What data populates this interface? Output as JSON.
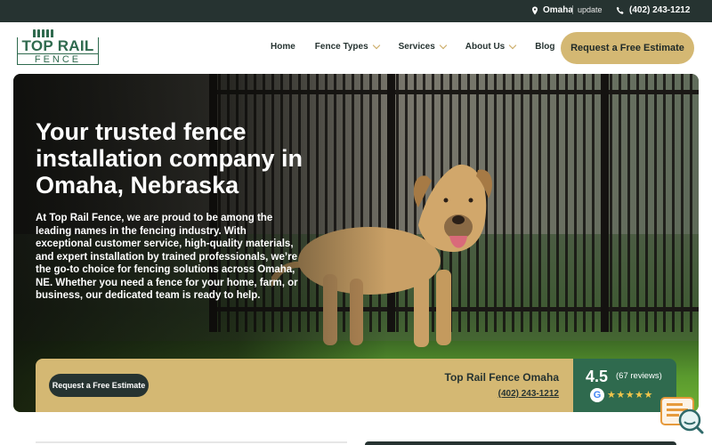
{
  "topbar": {
    "location": "Omaha",
    "update": "update",
    "phone": "(402) 243-1212"
  },
  "logo": {
    "line1": "TOP RAIL",
    "line2": "FENCE"
  },
  "nav": {
    "items": [
      {
        "label": "Home",
        "dropdown": false
      },
      {
        "label": "Fence Types",
        "dropdown": true
      },
      {
        "label": "Services",
        "dropdown": true
      },
      {
        "label": "About Us",
        "dropdown": true
      },
      {
        "label": "Blog",
        "dropdown": false
      }
    ],
    "cta": "Request a Free Estimate"
  },
  "hero": {
    "title": "Your trusted fence installation company in Omaha, Nebraska",
    "body": "At Top Rail Fence, we are proud to be among the leading names in the fencing industry. With exceptional customer service, high-quality materials, and expert installation by trained professionals, we’re the go-to choice for fencing solutions across Omaha, NE. Whether you need a fence for your home, farm, or business, our dedicated team is ready to help."
  },
  "infobar": {
    "button": "Request a Free Estimate",
    "name": "Top Rail Fence Omaha",
    "phone": "(402) 243-1212"
  },
  "rating": {
    "score": "4.5",
    "count": "(67 reviews)",
    "google": "G",
    "stars": "★★★★★"
  },
  "colors": {
    "dark": "#263331",
    "green": "#2f6a4e",
    "gold": "#d4b873"
  },
  "icons": [
    "location-pin-icon",
    "phone-icon",
    "chevron-down-icon",
    "google-icon",
    "star-icon",
    "chat-widget-icon"
  ]
}
